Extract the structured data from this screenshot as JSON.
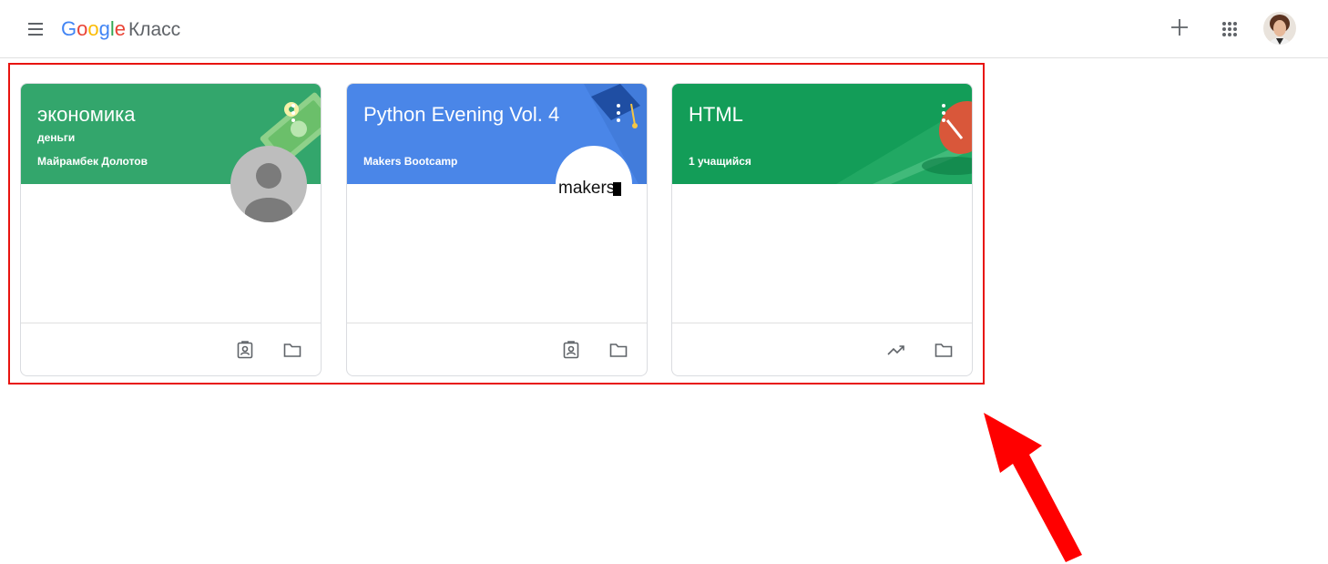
{
  "app": {
    "logo_google": [
      "G",
      "o",
      "o",
      "g",
      "l",
      "e"
    ],
    "product_name": "Класс"
  },
  "header": {
    "menu_icon": "hamburger-menu-icon",
    "actions": [
      "add-icon",
      "apps-grid-icon",
      "account-avatar"
    ]
  },
  "classes": [
    {
      "title": "экономика",
      "subtitle": "деньги",
      "owner": "Майрамбек Долотов",
      "color": "#33a66c",
      "footer_icons": [
        "assignments-icon",
        "folder-icon"
      ]
    },
    {
      "title": "Python Evening Vol. 4",
      "subtitle": "",
      "owner": "Makers Bootcamp",
      "color": "#4a86e8",
      "logo_text": "makers",
      "footer_icons": [
        "assignments-icon",
        "folder-icon"
      ]
    },
    {
      "title": "HTML",
      "subtitle": "",
      "owner": "1 учащийся",
      "color": "#139d58",
      "footer_icons": [
        "trending-up-icon",
        "folder-icon"
      ]
    }
  ],
  "annotations": {
    "highlight_color": "#e8130f",
    "arrow_color": "#ff0000"
  }
}
